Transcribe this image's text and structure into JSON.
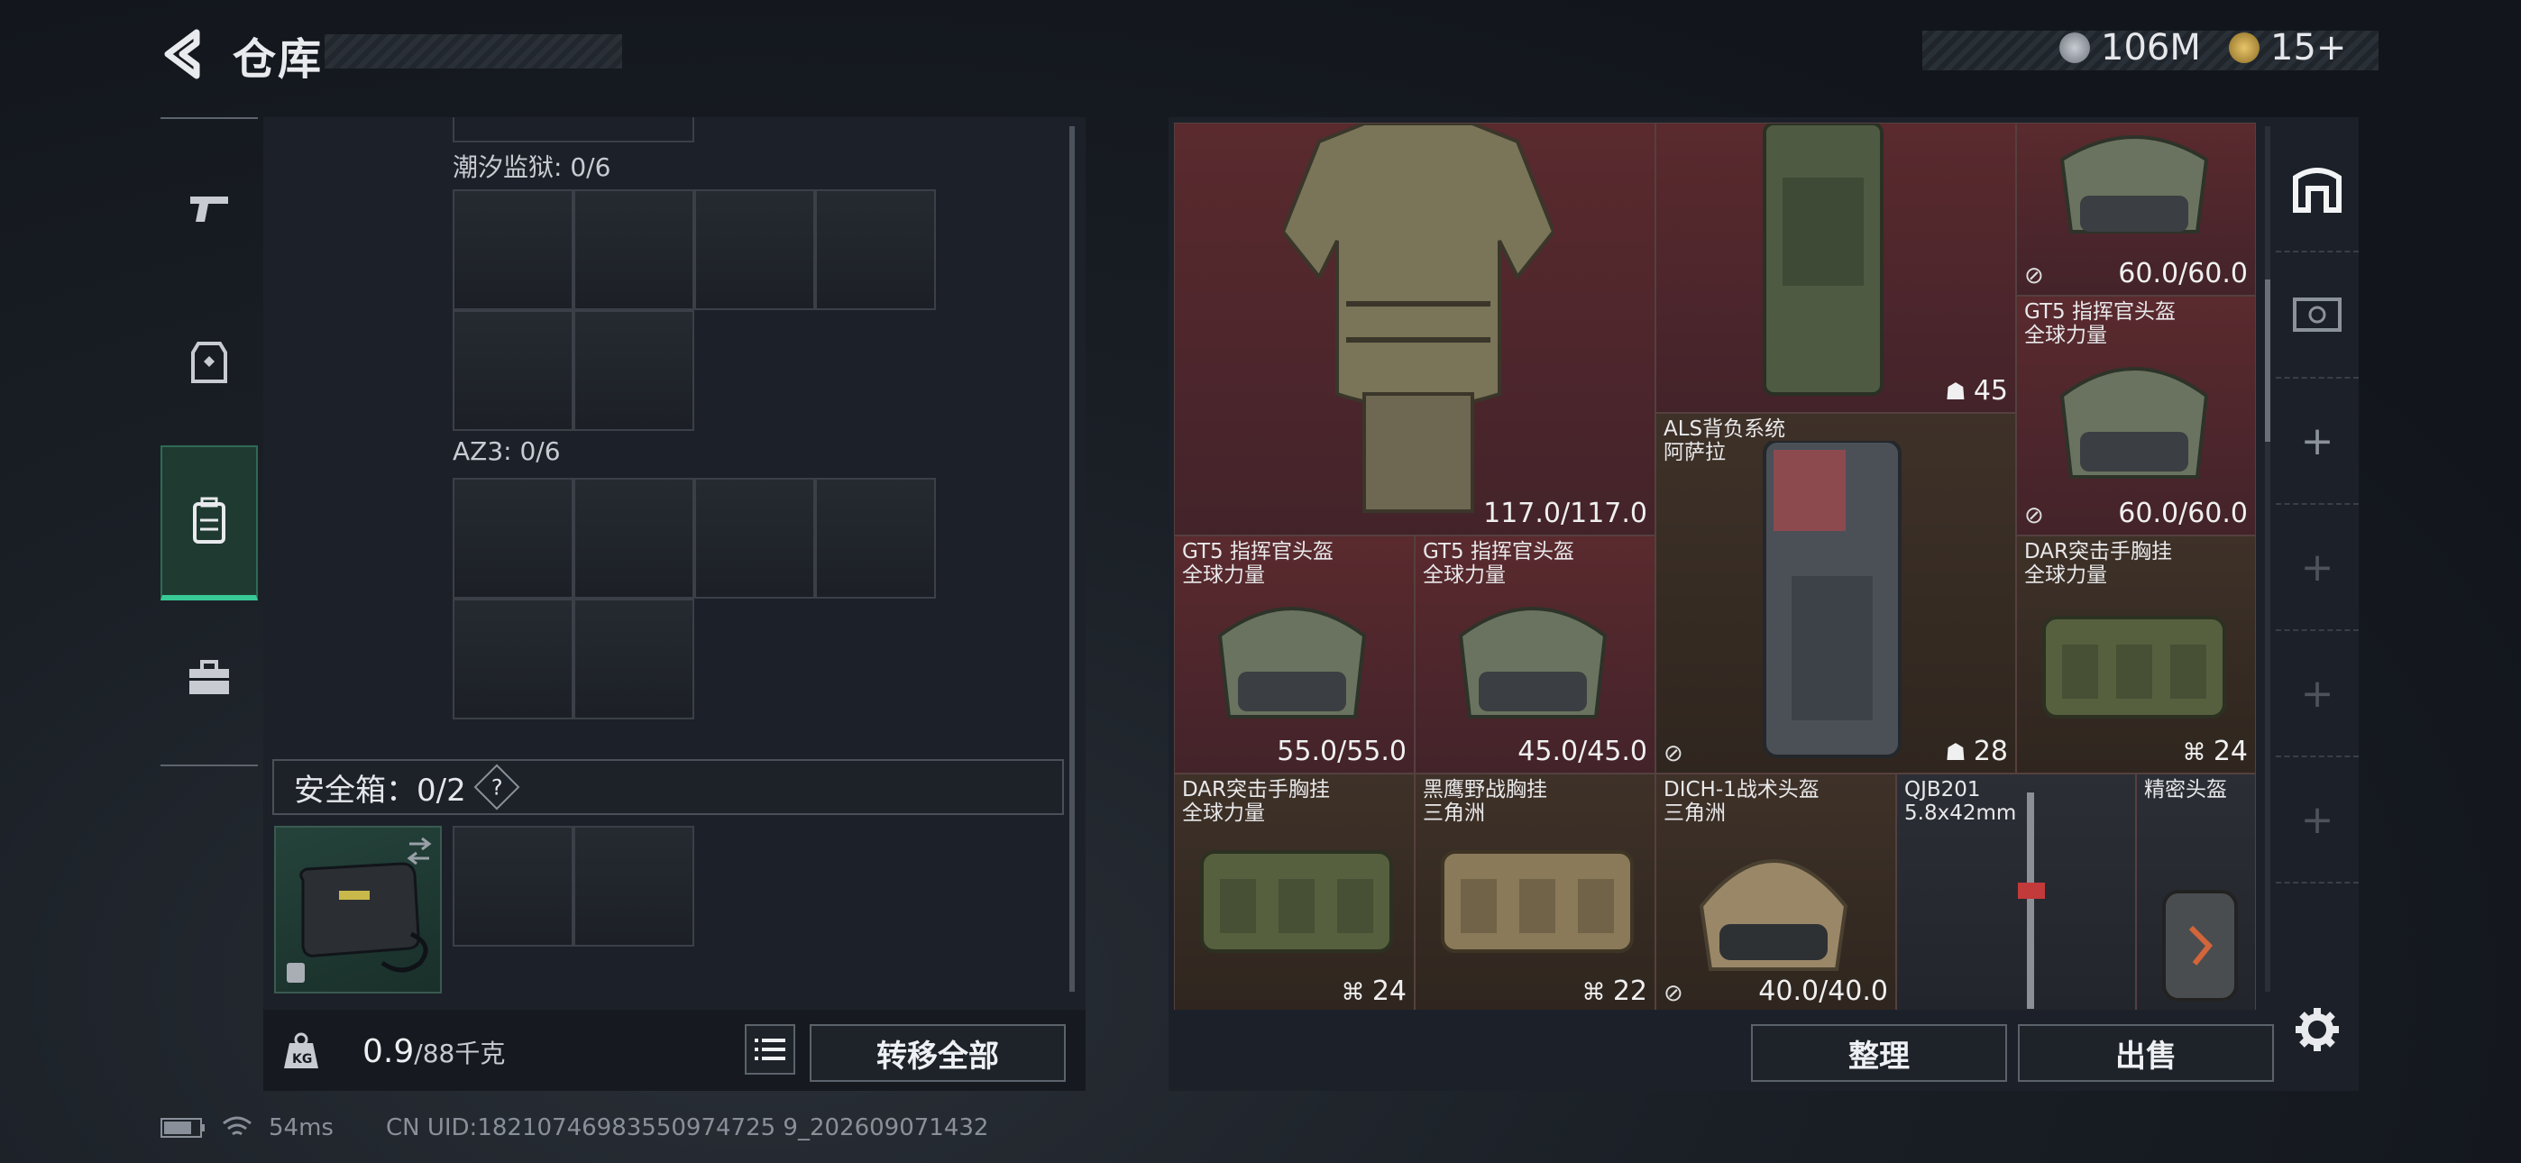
{
  "header": {
    "title": "仓库",
    "currency1": "106M",
    "currency2": "15+"
  },
  "left_nav": {
    "items": [
      "weapons-icon",
      "armor-icon",
      "backpack-icon",
      "toolbox-icon"
    ]
  },
  "containers": [
    {
      "label": "潮汐监狱: 0/6"
    },
    {
      "label": "AZ3: 0/6"
    }
  ],
  "safebox": {
    "label": "安全箱：0/2",
    "help": "?"
  },
  "bottom": {
    "weight_value": "0.9",
    "weight_max": "/88千克",
    "transfer_all": "转移全部",
    "sort": "整理",
    "sell": "出售"
  },
  "items": [
    {
      "name1": "",
      "name2": "",
      "value": "117.0/117.0"
    },
    {
      "name1": "",
      "name2": "",
      "value": "45"
    },
    {
      "name1": "",
      "name2": "",
      "value": "60.0/60.0"
    },
    {
      "name1": "GT5 指挥官头盔",
      "name2": "全球力量",
      "value": "60.0/60.0"
    },
    {
      "name1": "ALS背负系统",
      "name2": "阿萨拉",
      "value": "28"
    },
    {
      "name1": "GT5 指挥官头盔",
      "name2": "全球力量",
      "value": "55.0/55.0"
    },
    {
      "name1": "GT5 指挥官头盔",
      "name2": "全球力量",
      "value": "45.0/45.0"
    },
    {
      "name1": "DAR突击手胸挂",
      "name2": "全球力量",
      "value": "24"
    },
    {
      "name1": "DAR突击手胸挂",
      "name2": "全球力量",
      "value": "24"
    },
    {
      "name1": "黑鹰野战胸挂",
      "name2": "三角洲",
      "value": "22"
    },
    {
      "name1": "DICH-1战术头盔",
      "name2": "三角洲",
      "value": "40.0/40.0"
    },
    {
      "name1": "QJB201",
      "name2": "5.8x42mm",
      "value": ""
    },
    {
      "name1": "精密头盔",
      "name2": "",
      "value": ""
    }
  ],
  "status": {
    "ping": "54ms",
    "uid": "CN UID:18210746983550974725 9_202609071432"
  },
  "colors": {
    "accent_green": "#38c996",
    "rare_red": "#5a2a2e",
    "common_brown": "#3e3128"
  }
}
